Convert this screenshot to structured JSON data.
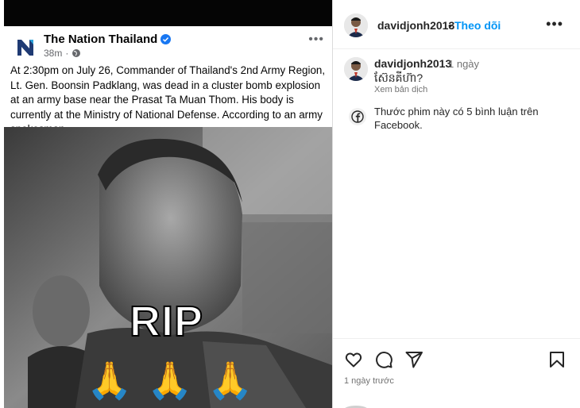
{
  "post_media": {
    "fb_page_name": "The Nation Thailand",
    "fb_post_time": "38m",
    "fb_post_text": "At 2:30pm on July 26, Commander of Thailand's 2nd Army Region, Lt. Gen. Boonsin Padklang, was dead in a cluster bomb explosion at an army base near the Prasat Ta Muan Thom. His body is currently at the Ministry of National Defense. According to an army spokesman.",
    "overlay_text": "RIP",
    "overlay_emoji": "🙏"
  },
  "header": {
    "username": "davidjonh2013",
    "separator": "•",
    "follow_label": "Theo dõi",
    "more_icon": "more-horizontal-icon"
  },
  "caption": {
    "username": "davidjonh2013",
    "time": "1 ngày",
    "text": "ស៊ែនគីហ៊ា?",
    "translate_label": "Xem bản dịch"
  },
  "facebook_comments": {
    "icon": "facebook-icon",
    "text": "Thước phim này có 5 bình luận trên Facebook."
  },
  "footer": {
    "actions": [
      "heart-icon",
      "comment-icon",
      "share-icon",
      "bookmark-icon"
    ],
    "post_time": "1 ngày trước"
  },
  "colors": {
    "follow_blue": "#0095f6",
    "verified_blue": "#1877f2",
    "text_primary": "#262626",
    "text_secondary": "#737373"
  }
}
